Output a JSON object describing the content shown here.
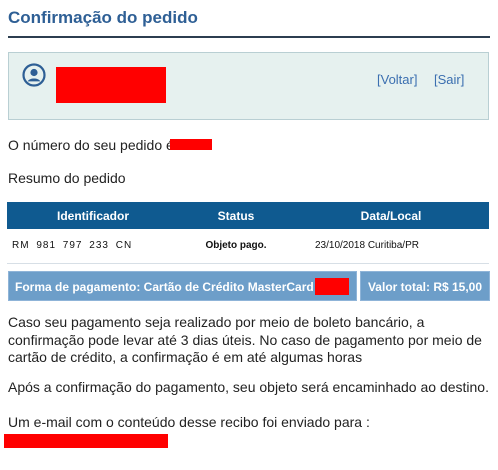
{
  "page": {
    "title": "Confirmação do pedido"
  },
  "user_box": {
    "icon": "user-icon",
    "links": {
      "voltar": "[Voltar]",
      "sair": "[Sair]"
    }
  },
  "order": {
    "number_text": "O número do seu pedido é",
    "summary_label": "Resumo do pedido"
  },
  "table": {
    "headers": [
      "Identificador",
      "Status",
      "Data/Local"
    ],
    "rows": [
      {
        "id": "RM 981 797 233 CN",
        "status": "Objeto pago.",
        "date_local": "23/10/2018 Curitiba/PR"
      }
    ]
  },
  "payment": {
    "method": "Forma de pagamento: Cartão de Crédito MasterCard",
    "total": "Valor total: R$ 15,00"
  },
  "messages": {
    "p1": "Caso seu pagamento seja realizado por meio de boleto bancário, a confirmação pode levar até 3 dias úteis. No caso de pagamento por meio de cartão de crédito, a confirmação é em até algumas horas",
    "p2": "Após a confirmação do pagamento, seu objeto será encaminhado ao destino.",
    "p3": "Um e-mail com o conteúdo desse recibo foi enviado para :"
  },
  "colors": {
    "title": "#2e5f95",
    "table_header": "#0f5a90",
    "payment_bar": "#6d9ec9",
    "user_box_bg": "#e6f1ef",
    "redaction": "#ff0000"
  }
}
